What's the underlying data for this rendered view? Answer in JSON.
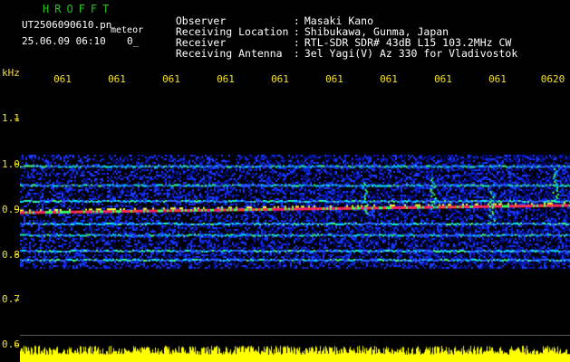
{
  "header": {
    "app_title": "HROFFT",
    "file_name": "UT2506090610.pn",
    "mode_label": "meteor",
    "date_time": "25.06.09 06:10",
    "status_small": "0_"
  },
  "info": [
    {
      "label": "Observer",
      "value": "Masaki Kano"
    },
    {
      "label": "Receiving Location",
      "value": "Shibukawa, Gunma, Japan"
    },
    {
      "label": "Receiver",
      "value": "RTL-SDR SDR# 43dB L15 103.2MHz CW"
    },
    {
      "label": "Receiving Antenna",
      "value": "3el Yagi(V) Az 330 for Vladivostok"
    }
  ],
  "axis": {
    "y_unit": "kHz",
    "y_ticks": [
      "1.1",
      "1.0",
      "0.9",
      "0.8",
      "0.7",
      "0.6"
    ],
    "x_ticks": [
      "061",
      "061",
      "061",
      "061",
      "061",
      "061",
      "061",
      "061",
      "061",
      "0620"
    ]
  },
  "colors": {
    "header_title": "#22c51c",
    "axis_text": "#f2e22a",
    "amplitude": "#ffff00",
    "background": "#000000"
  },
  "spectrogram": {
    "type": "heatmap",
    "strong_signal_khz": 0.895,
    "carrier_lines_khz": [
      0.997,
      0.955,
      0.92,
      0.87,
      0.845,
      0.81,
      0.79
    ],
    "band_range_khz": [
      0.77,
      1.02
    ]
  }
}
